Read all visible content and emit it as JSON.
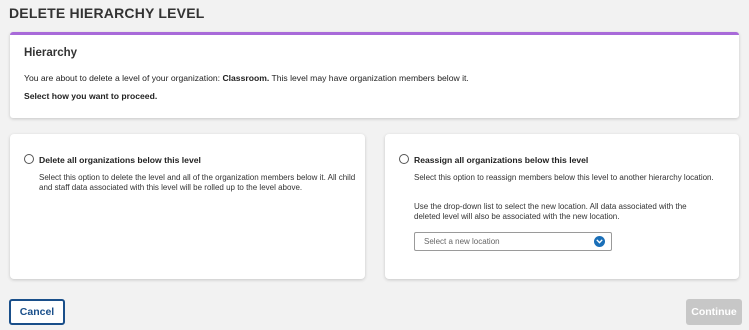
{
  "page": {
    "title": "DELETE HIERARCHY LEVEL"
  },
  "hierarchy": {
    "title": "Hierarchy",
    "message_prefix": "You are about to delete a level of your organization: ",
    "level_name": "Classroom.",
    "message_suffix": " This level may have organization members below it.",
    "proceed_prompt": "Select how you want to proceed."
  },
  "options": {
    "delete_all": {
      "label": "Delete all organizations below this level",
      "description": "Select this option to delete the level and all of the organization members below it. All child and staff data associated with this level will be rolled up to the level above."
    },
    "reassign_all": {
      "label": "Reassign all organizations below this level",
      "description_1": "Select this option to reassign members below this level to another hierarchy location.",
      "description_2": "Use the drop-down list to select the new location. All data associated with the deleted level will also be associated with the new location.",
      "select_placeholder": "Select a new location"
    }
  },
  "actions": {
    "cancel_label": "Cancel",
    "continue_label": "Continue"
  },
  "colors": {
    "accent_purple": "#a86ad9",
    "primary_blue": "#1a4f8a",
    "chevron_blue": "#1a6fb8",
    "disabled_gray": "#c7c7c7"
  }
}
